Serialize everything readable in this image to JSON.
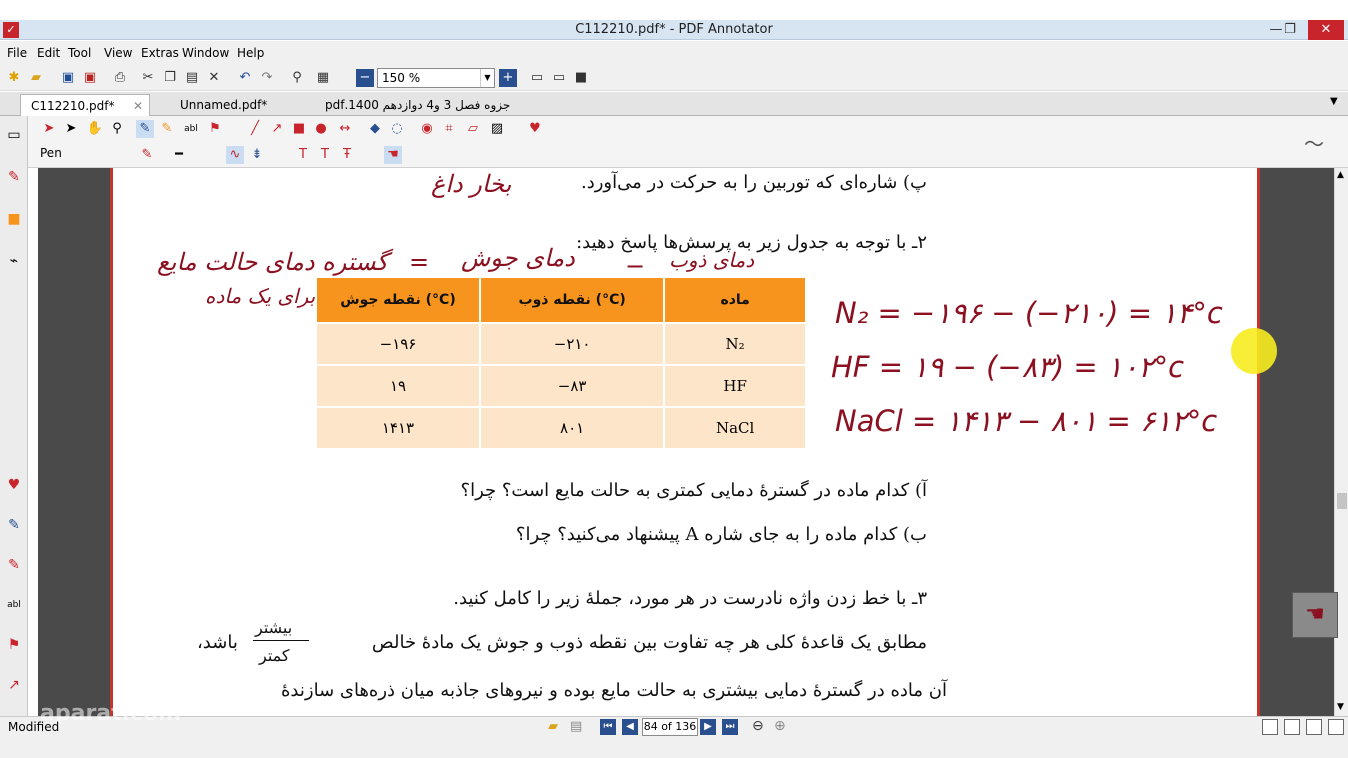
{
  "window": {
    "title": "C112210.pdf* - PDF Annotator",
    "logo": "✓",
    "minimize": "—",
    "restore": "❐",
    "close": "✕"
  },
  "menu": [
    "File",
    "Edit",
    "Tool",
    "View",
    "Extras",
    "Window",
    "Help"
  ],
  "toolbar": {
    "zoom": "150 %"
  },
  "tabs": [
    {
      "label": "C112210.pdf*"
    },
    {
      "label": "Unnamed.pdf*"
    },
    {
      "label": "جزوه فصل 3 و4 دوازدهم 1400.pdf"
    }
  ],
  "tool": {
    "current": "Pen"
  },
  "document": {
    "line_p": "پ) شاره‌ای که توربین را به حرکت در می‌آورد.",
    "q2": "۲ـ با توجه به جدول زیر به پرسش‌ها پاسخ دهید:",
    "table": {
      "headers": [
        "ماده",
        "نقطه ذوب (°C)",
        "نقطه جوش (°C)"
      ],
      "rows": [
        [
          "N₂",
          "−۲۱۰",
          "−۱۹۶"
        ],
        [
          "HF",
          "−۸۳",
          "۱۹"
        ],
        [
          "NaCl",
          "۸۰۱",
          "۱۴۱۳"
        ]
      ]
    },
    "qa": "آ) کدام ماده در گسترهٔ دمایی کمتری به حالت مایع است؟ چرا؟",
    "qb": "ب) کدام ماده را به جای شاره A پیشنهاد می‌کنید؟ چرا؟",
    "q3": "۳ـ با خط زدن واژه نادرست در هر مورد، جملهٔ زیر را کامل کنید.",
    "line4_start": "مطابق یک قاعدهٔ کلی هر چه تفاوت بین نقطه ذوب و جوش یک مادهٔ خالص",
    "frac_top": "بیشتر",
    "frac_bottom": "کمتر",
    "line4_end": "باشد،",
    "line5": "آن ماده در گسترهٔ دمایی بیشتری به حالت مایع بوده و نیروهای جاذبه میان ذره‌های سازندهٔ"
  },
  "handwriting": {
    "steam": "بخار داغ",
    "range_title": "گستره دمای حالت مایع",
    "range_sub": "برای یک ماده",
    "equals": "=",
    "boil": "دمای جوش",
    "minus": "−",
    "melt": "دمای ذوب",
    "eq1": "N₂ = −۱۹۶ − (−۲۱۰) = ۱۴°c",
    "eq2": "HF = ۱۹ − (−۸۳) = ۱۰۲°c",
    "eq3": "NaCl = ۱۴۱۳ − ۸۰۱ = ۶۱۲°c"
  },
  "status": {
    "text": "Modified",
    "page": "84 of 136",
    "watermark": "aparat.com"
  }
}
